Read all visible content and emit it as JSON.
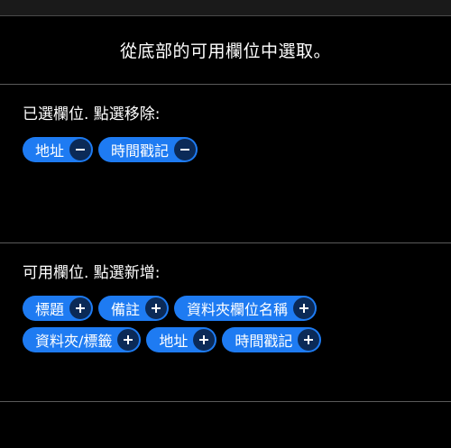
{
  "instruction": "從底部的可用欄位中選取。",
  "selected": {
    "title": "已選欄位. 點選移除:",
    "items": [
      {
        "label": "地址"
      },
      {
        "label": "時間戳記"
      }
    ]
  },
  "available": {
    "title": "可用欄位. 點選新增:",
    "items": [
      {
        "label": "標題"
      },
      {
        "label": "備註"
      },
      {
        "label": "資料夾欄位名稱"
      },
      {
        "label": "資料夾/標籤"
      },
      {
        "label": "地址"
      },
      {
        "label": "時間戳記"
      }
    ]
  },
  "icons": {
    "remove": "minus-icon",
    "add": "plus-icon"
  },
  "colors": {
    "chip_bg": "#1e7bf2",
    "chip_button_bg": "#0b2a57",
    "background": "#000000"
  }
}
